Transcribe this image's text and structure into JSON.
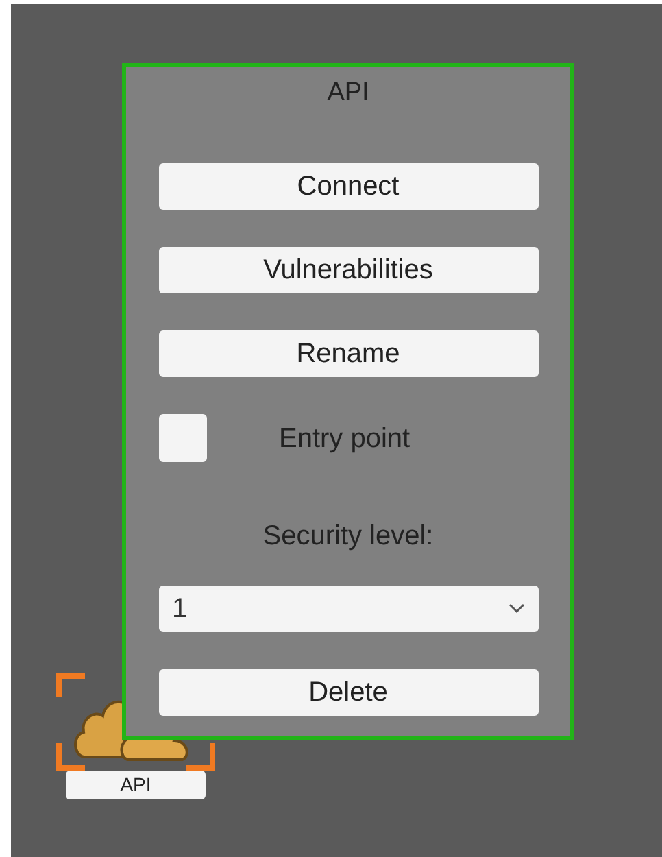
{
  "node": {
    "label": "API",
    "selected": true
  },
  "panel": {
    "title": "API",
    "buttons": [
      {
        "label": "Connect"
      },
      {
        "label": "Vulnerabilities"
      },
      {
        "label": "Rename"
      }
    ],
    "entry_point": {
      "label": "Entry point",
      "checked": false
    },
    "security_label": "Security level:",
    "security_select": {
      "value": "1"
    },
    "delete_button": "Delete"
  }
}
